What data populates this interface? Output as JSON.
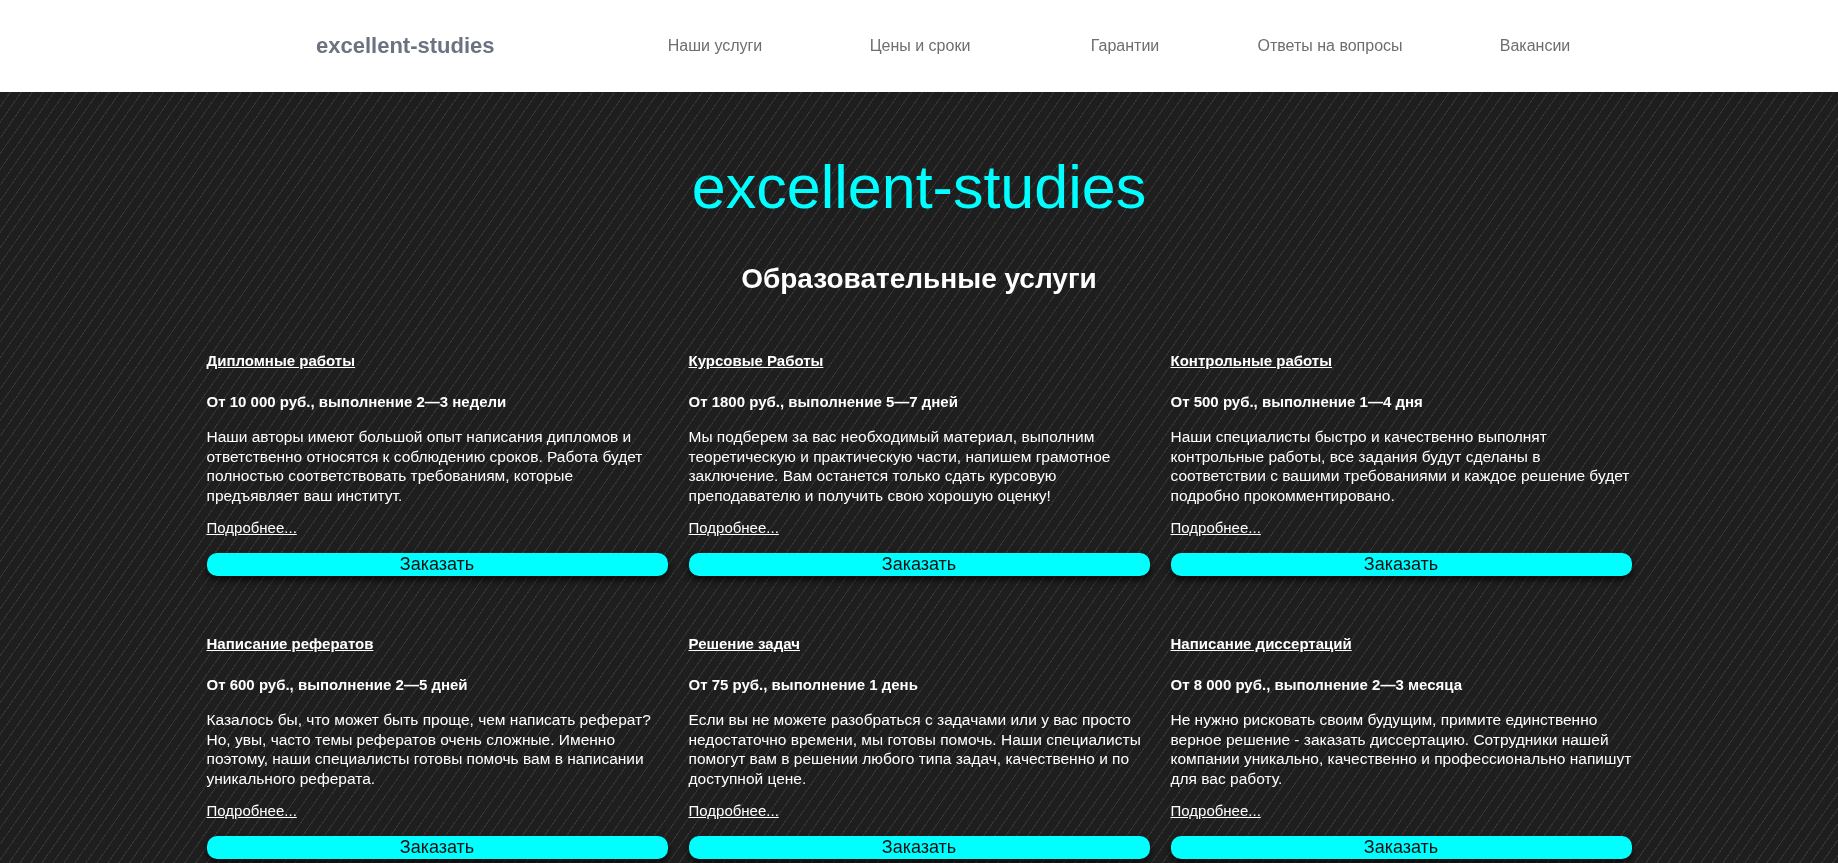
{
  "header": {
    "logo": "excellent-studies",
    "nav": [
      "Наши услуги",
      "Цены и сроки",
      "Гарантии",
      "Ответы на вопросы",
      "Вакансии"
    ]
  },
  "hero": {
    "title": "excellent-studies",
    "subtitle": "Образовательные услуги"
  },
  "services": [
    {
      "title": "Дипломные работы",
      "price": "От 10 000 руб., выполнение 2—3 недели",
      "description": "Наши авторы имеют большой опыт написания дипломов и ответственно относятся к соблюдению сроков. Работа будет полностью соответствовать требованиям, которые предъявляет ваш институт.",
      "more": "Подробнее...",
      "button": "Заказать"
    },
    {
      "title": "Курсовые Работы",
      "price": "От 1800 руб., выполнение 5—7 дней",
      "description": "Мы подберем за вас необходимый материал, выполним теоретическую и практическую части, напишем грамотное заключение. Вам останется только сдать курсовую преподавателю и получить свою хорошую оценку!",
      "more": "Подробнее...",
      "button": "Заказать"
    },
    {
      "title": "Контрольные работы",
      "price": "От 500 руб., выполнение 1—4 дня",
      "description": "Наши специалисты быстро и качественно выполнят контрольные работы, все задания будут сделаны в соответствии с вашими требованиями и каждое решение будет подробно прокомментировано.",
      "more": "Подробнее...",
      "button": "Заказать"
    },
    {
      "title": "Написание рефератов",
      "price": "От 600 руб., выполнение 2—5 дней",
      "description": "Казалось бы, что может быть проще, чем написать реферат? Но, увы, часто темы рефератов очень сложные. Именно поэтому, наши специалисты готовы помочь вам в написании уникального реферата.",
      "more": "Подробнее...",
      "button": "Заказать"
    },
    {
      "title": "Решение задач",
      "price": "От 75 руб., выполнение 1 день",
      "description": "Если вы не можете разобраться с задачами или у вас просто недостаточно времени, мы готовы помочь. Наши специалисты помогут вам в решении любого типа задач, качественно и по доступной цене.",
      "more": "Подробнее...",
      "button": "Заказать"
    },
    {
      "title": "Написание диссертаций",
      "price": "От 8 000 руб., выполнение 2—3 месяца",
      "description": "Не нужно рисковать своим будущим, примите единственно верное решение - заказать диссертацию. Сотрудники нашей компании уникально, качественно и профессионально напишут для вас работу.",
      "more": "Подробнее...",
      "button": "Заказать"
    }
  ]
}
